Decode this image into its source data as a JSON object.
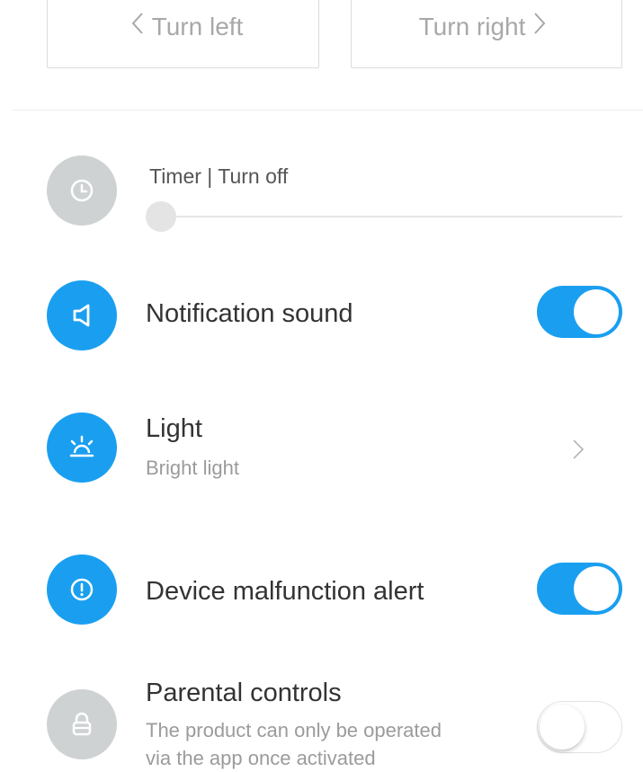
{
  "turn_buttons": {
    "left_label": "Turn left",
    "right_label": "Turn right"
  },
  "timer": {
    "title": "Timer | Turn off",
    "slider_value": 0,
    "icon": "clock-icon"
  },
  "settings": {
    "notification_sound": {
      "title": "Notification sound",
      "enabled": true,
      "icon": "speaker-icon"
    },
    "light": {
      "title": "Light",
      "value": "Bright light",
      "icon": "light-icon"
    },
    "malfunction_alert": {
      "title": "Device malfunction alert",
      "enabled": true,
      "icon": "alert-icon"
    },
    "parental_controls": {
      "title": "Parental controls",
      "description_line1": "The product can only be operated",
      "description_line2": "via the app once activated",
      "enabled": false,
      "icon": "lock-icon"
    }
  },
  "colors": {
    "accent": "#1a9ff0",
    "inactive_icon": "#cfd2d3"
  }
}
